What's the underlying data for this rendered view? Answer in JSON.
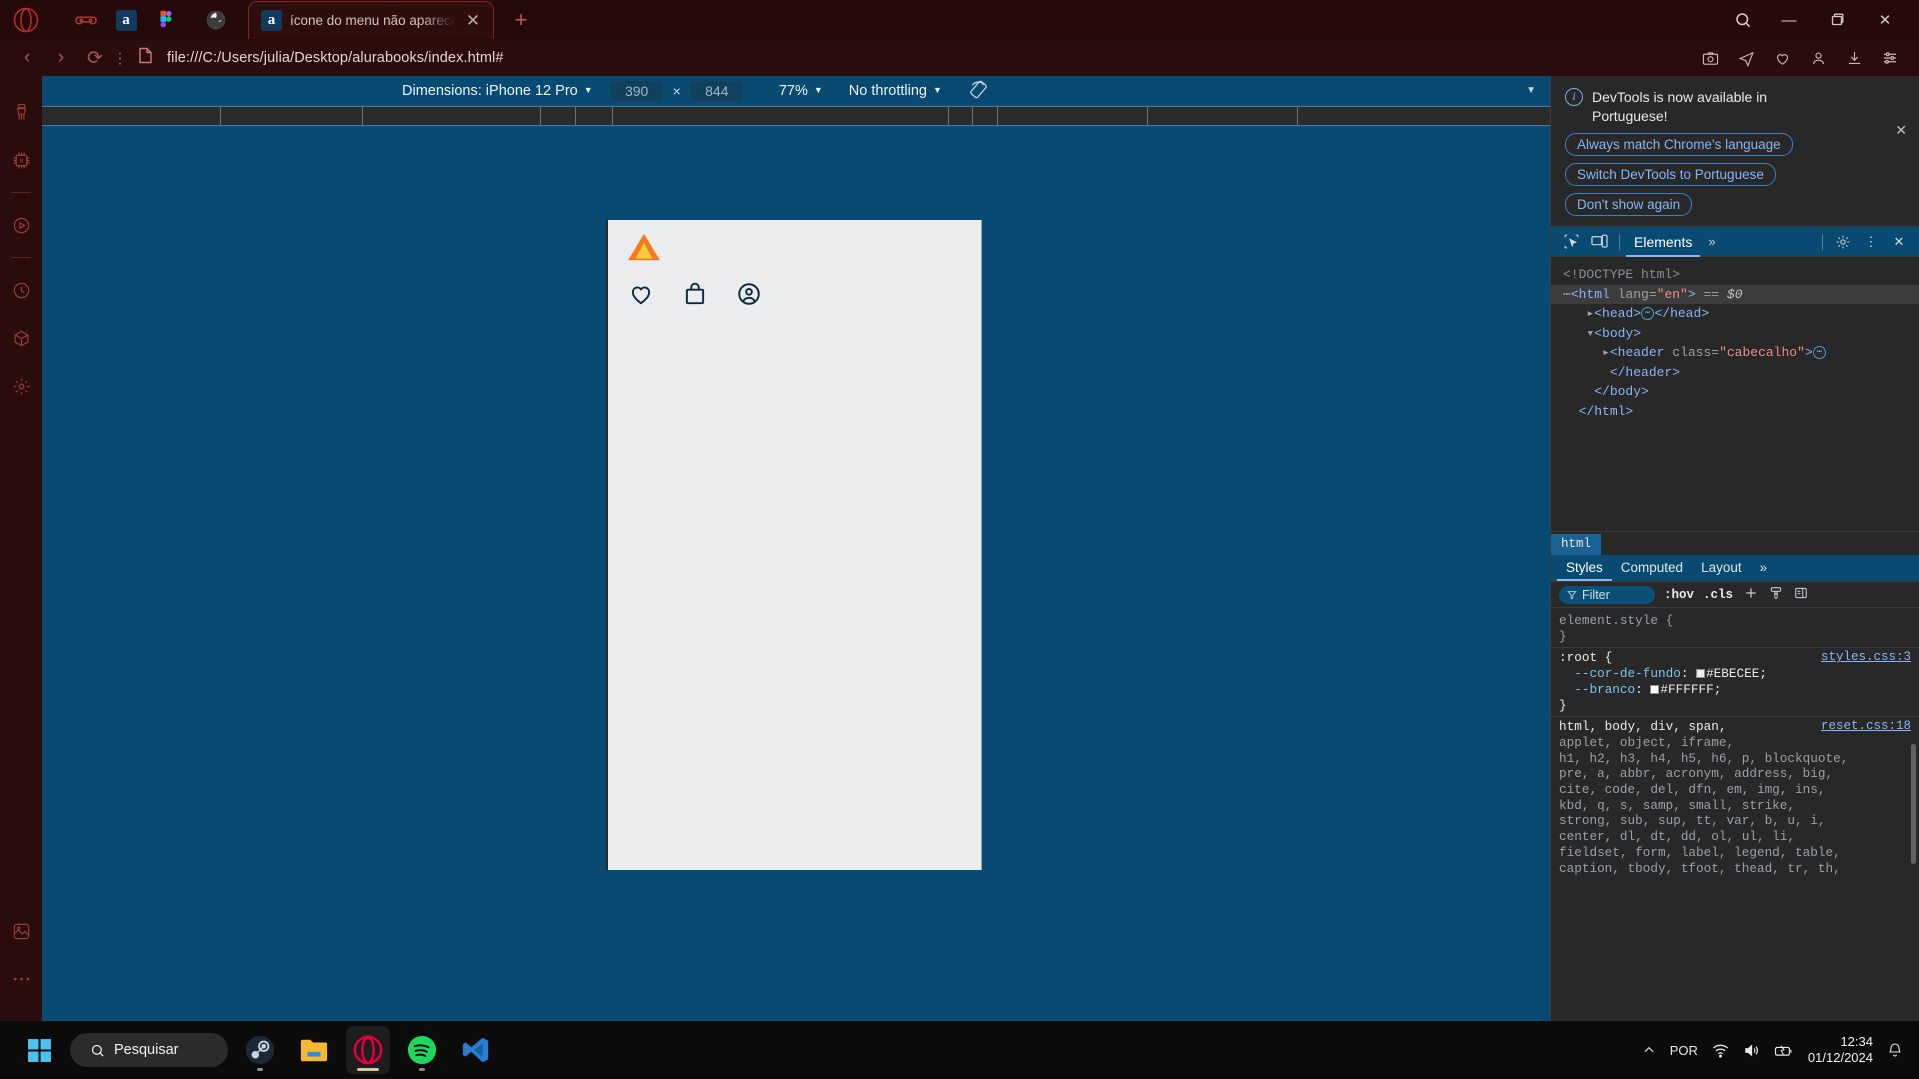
{
  "browser": {
    "name": "Opera",
    "tab_icons": [
      "game-controller-icon",
      "amazon-icon",
      "figma-icon"
    ],
    "pinned_globe_tab": "globe-icon",
    "active_tab": {
      "favicon": "amazon-icon",
      "title": "ícone do menu não aparece",
      "close_label": "✕"
    },
    "new_tab_label": "+",
    "window_controls": {
      "minimize": "—",
      "maximize": "❐",
      "close": "✕"
    },
    "search_icon": "search-icon",
    "toolbar": {
      "back": "‹",
      "forward": "›",
      "reload": "⟳",
      "menu_dots": "⋮",
      "page_icon": "page-icon",
      "url": "file:///C:/Users/julia/Desktop/alurabooks/index.html#",
      "right_icons": [
        "snapshot-icon",
        "send-icon",
        "heart-icon",
        "profile-icon",
        "download-icon",
        "easy-setup-icon"
      ]
    },
    "sidebar_icons": [
      "cleaner-icon",
      "aria-ai-icon",
      "player-icon",
      "history-icon",
      "package-icon",
      "settings-icon"
    ]
  },
  "device_toolbar": {
    "dimensions_label": "Dimensions: iPhone 12 Pro",
    "width": "390",
    "height": "844",
    "x_symbol": "×",
    "zoom": "77%",
    "throttling": "No throttling",
    "rotate_icon": "rotate-icon",
    "more_options": "▼"
  },
  "page": {
    "logo": "alura-logo",
    "header_icons": [
      "heart-icon",
      "shopping-bag-icon",
      "account-icon"
    ],
    "background_color": "#EBECEE"
  },
  "devtools": {
    "notification": {
      "icon": "info-icon",
      "message": "DevTools is now available in Portuguese!",
      "buttons": [
        "Always match Chrome's language",
        "Switch DevTools to Portuguese",
        "Don't show again"
      ],
      "close": "✕"
    },
    "toolbar": {
      "inspect_icon": "inspect-element-icon",
      "device_toggle_icon": "device-toolbar-icon",
      "active_tab": "Elements",
      "more_tabs": "»",
      "settings_icon": "gear-icon",
      "more_icon": "⋮",
      "close_icon": "✕"
    },
    "dom": {
      "lines": [
        {
          "kind": "doctype",
          "text": "<!DOCTYPE html>"
        },
        {
          "kind": "html_open",
          "tag": "html",
          "attr": "lang",
          "value": "en",
          "suffix": "== $0"
        },
        {
          "kind": "head",
          "text": "<head>…</head>"
        },
        {
          "kind": "body_open",
          "text": "<body>"
        },
        {
          "kind": "header",
          "tag": "header",
          "attr": "class",
          "value": "cabecalho"
        },
        {
          "kind": "header_close",
          "text": "</header>"
        },
        {
          "kind": "body_close",
          "text": "</body>"
        },
        {
          "kind": "html_close",
          "text": "</html>"
        }
      ]
    },
    "breadcrumb": [
      "html"
    ],
    "style_tabs": [
      "Styles",
      "Computed",
      "Layout"
    ],
    "style_tabs_more": "»",
    "filter": {
      "icon": "filter-icon",
      "placeholder": "Filter",
      "hov": ":hov",
      "cls": ".cls",
      "new_rule_icon": "plus-icon",
      "class_icon": "paintbrush-icon",
      "sidebar_icon": "toggle-sidebar-icon"
    },
    "rules": [
      {
        "selector": "element.style {",
        "close": "}",
        "source": "",
        "declarations": []
      },
      {
        "selector": ":root {",
        "close": "}",
        "source": "styles.css:3",
        "declarations": [
          {
            "prop": "--cor-de-fundo",
            "value": "#EBECEE",
            "swatch": "#EBECEE"
          },
          {
            "prop": "--branco",
            "value": "#FFFFFF",
            "swatch": "#FFFFFF"
          }
        ]
      }
    ],
    "reset_rule": {
      "source": "reset.css:18",
      "lines": [
        "html, body, div, span,",
        "applet, object, iframe,",
        "h1, h2, h3, h4, h5, h6, p, blockquote,",
        "pre, a, abbr, acronym, address, big,",
        "cite, code, del, dfn, em, img, ins,",
        "kbd, q, s, samp, small, strike,",
        "strong, sub, sup, tt, var, b, u, i,",
        "center, dl, dt, dd, ol, ul, li,",
        "fieldset, form, label, legend, table,",
        "caption, tbody, tfoot, thead, tr, th,"
      ]
    }
  },
  "taskbar": {
    "start_icon": "windows-start-icon",
    "search_placeholder": "Pesquisar",
    "search_icon": "search-icon",
    "apps": [
      "steam-icon",
      "file-explorer-icon",
      "opera-icon",
      "spotify-icon",
      "vscode-icon"
    ],
    "tray": {
      "expand_icon": "chevron-up-icon",
      "language": "POR",
      "wifi_icon": "wifi-icon",
      "volume_icon": "volume-icon",
      "battery_icon": "battery-icon",
      "time": "12:34",
      "date": "01/12/2024",
      "notification_icon": "bell-icon"
    }
  }
}
